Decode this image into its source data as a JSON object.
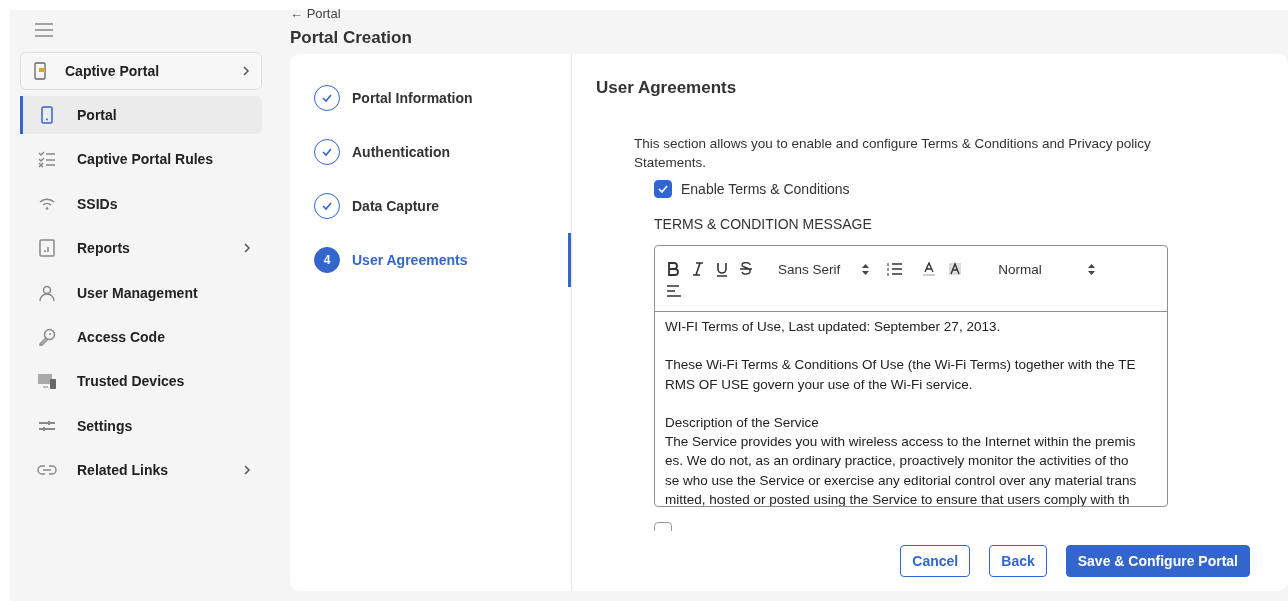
{
  "sidebar": {
    "header": {
      "label": "Captive Portal",
      "chevron": true
    },
    "items": [
      {
        "label": "Portal",
        "selected": true,
        "chevron": false
      },
      {
        "label": "Captive Portal Rules",
        "selected": false,
        "chevron": false
      },
      {
        "label": "SSIDs",
        "selected": false,
        "chevron": false
      },
      {
        "label": "Reports",
        "selected": false,
        "chevron": true
      },
      {
        "label": "User Management",
        "selected": false,
        "chevron": false
      },
      {
        "label": "Access Code",
        "selected": false,
        "chevron": false
      },
      {
        "label": "Trusted Devices",
        "selected": false,
        "chevron": false
      },
      {
        "label": "Settings",
        "selected": false,
        "chevron": false
      },
      {
        "label": "Related Links",
        "selected": false,
        "chevron": true
      }
    ]
  },
  "back_arrow": "←",
  "breadcrumb": "Portal",
  "page_title": "Portal Creation",
  "steps": [
    {
      "label": "Portal Information",
      "done": true,
      "selected": false
    },
    {
      "label": "Authentication",
      "done": true,
      "selected": false
    },
    {
      "label": "Data Capture",
      "done": true,
      "selected": false
    },
    {
      "label": "User Agreements",
      "number": "4",
      "done": false,
      "selected": true
    }
  ],
  "section_title": "User Agreements",
  "intro": "This section allows you to enable and configure Terms & Conditions and Privacy policy Statements.",
  "terms_checkbox": {
    "label": "Enable Terms & Conditions",
    "checked": true
  },
  "message_label": "TERMS & CONDITION MESSAGE",
  "editor": {
    "font": "Sans Serif",
    "size": "Normal",
    "paragraphs": [
      [
        "WI-FI Terms of Use, Last updated: September 27, 2013."
      ],
      [
        "These Wi-Fi Terms & Conditions Of Use (the Wi-Fi Terms) together with the TE",
        "RMS OF USE govern your use of the Wi-Fi service."
      ],
      [
        "Description of the Service",
        "The Service provides you with wireless access to the Internet within the premis",
        "es. We do not, as an ordinary practice, proactively monitor the activities of tho",
        "se who use the Service or exercise any editorial control over any material trans",
        "mitted, hosted or posted using the Service to ensure that users comply with th"
      ]
    ]
  },
  "privacy_checkbox": {
    "checked": false
  },
  "buttons": [
    {
      "label": "Cancel",
      "kind": "outline"
    },
    {
      "label": "Back",
      "kind": "outline"
    },
    {
      "label": "Save & Configure Portal",
      "kind": "primary"
    }
  ]
}
